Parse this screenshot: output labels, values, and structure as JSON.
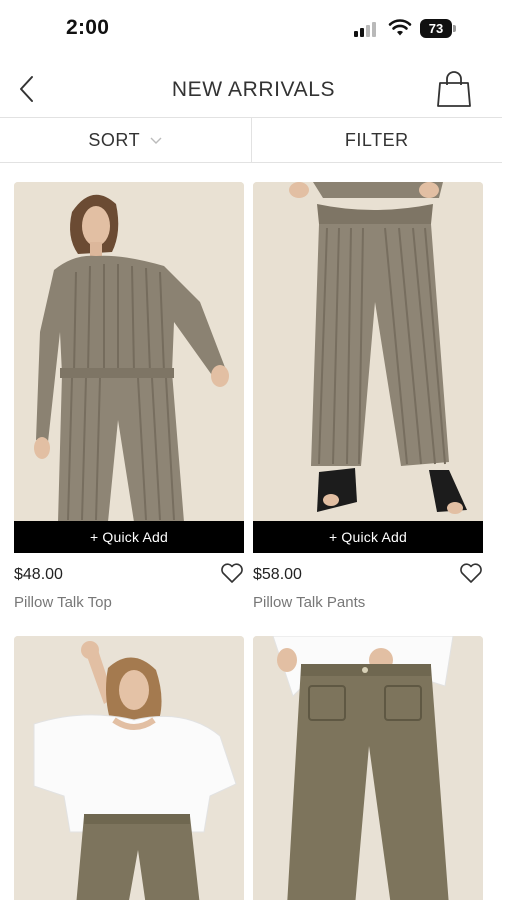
{
  "status_bar": {
    "time": "2:00",
    "battery": "73",
    "icons": [
      "signal-icon",
      "wifi-icon",
      "battery-icon"
    ]
  },
  "header": {
    "title": "NEW ARRIVALS",
    "back_icon": "chevron-left-icon",
    "bag_icon": "shopping-bag-icon"
  },
  "toolbar": {
    "sort_label": "SORT",
    "filter_label": "FILTER"
  },
  "products": [
    {
      "price": "$48.00",
      "name": "Pillow Talk Top",
      "quick_add": "+ Quick Add"
    },
    {
      "price": "$58.00",
      "name": "Pillow Talk Pants",
      "quick_add": "+ Quick Add"
    },
    {
      "price": "",
      "name": ""
    },
    {
      "price": "",
      "name": ""
    }
  ],
  "colors": {
    "quick_add_bg": "#000000",
    "photo_bg": "#e8e0d2",
    "knit": "#8b8272"
  }
}
